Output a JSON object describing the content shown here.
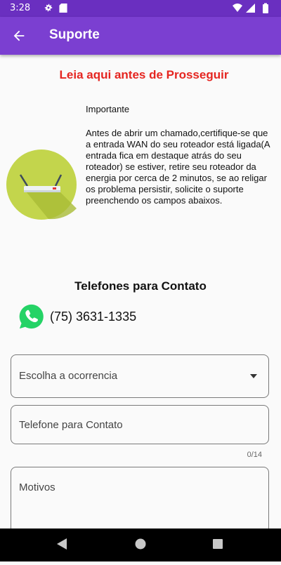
{
  "statusbar": {
    "time": "3:28",
    "icons": [
      "gear-icon",
      "sd-card-icon",
      "wifi-icon",
      "signal-icon",
      "battery-icon"
    ]
  },
  "appbar": {
    "title": "Suporte",
    "back_icon": "arrow-back-icon"
  },
  "notice": {
    "warning": "Leia aqui antes de Prosseguir",
    "heading": "Importante",
    "text": "Antes de abrir um chamado,certifique-se que a entrada WAN do seu roteador está ligada(A entrada fica em destaque atrás do seu roteador) se estiver, retire seu roteador da energia por cerca de 2 minutos, se ao religar os problema persistir, solicite o suporte preenchendo os campos abaixos."
  },
  "contacts": {
    "heading": "Telefones para Contato",
    "phone": "(75) 3631-1335",
    "icon": "whatsapp-icon"
  },
  "form": {
    "occurrence_label": "Escolha a ocorrencia",
    "phone_label": "Telefone para Contato",
    "phone_counter": "0/14",
    "reason_label": "Motivos"
  },
  "colors": {
    "primary": "#7b3fd1",
    "status_bar": "#6a2fc0",
    "warning": "#e52520",
    "whatsapp": "#25d366",
    "router_circle": "#c3d54c"
  }
}
